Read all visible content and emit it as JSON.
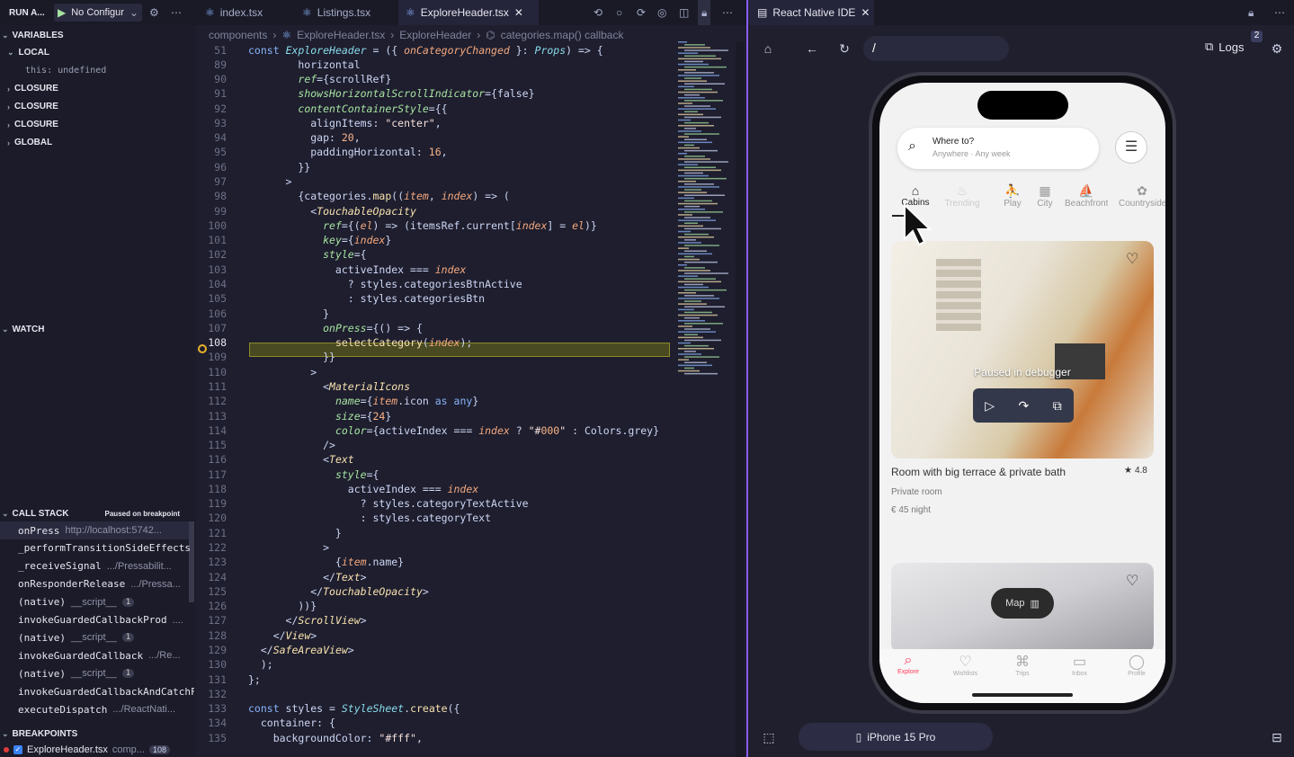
{
  "toolbar": {
    "run_label": "RUN A...",
    "config_label": "No Configur",
    "tabs": [
      {
        "label": "index.tsx"
      },
      {
        "label": "Listings.tsx"
      },
      {
        "label": "ExploreHeader.tsx"
      }
    ],
    "right_tab": "React Native IDE"
  },
  "debug": {
    "variables": "VARIABLES",
    "local": "LOCAL",
    "this_value": "this: undefined",
    "closures": [
      "CLOSURE",
      "CLOSURE",
      "CLOSURE"
    ],
    "global": "GLOBAL",
    "watch": "WATCH",
    "call_stack": "CALL STACK",
    "paused": "Paused on breakpoint",
    "frames": [
      {
        "fn": "onPress",
        "loc": "http://localhost:5742...",
        "badge": ""
      },
      {
        "fn": "_performTransitionSideEffects",
        "loc": "",
        "badge": ""
      },
      {
        "fn": "_receiveSignal",
        "loc": ".../Pressabilit...",
        "badge": ""
      },
      {
        "fn": "onResponderRelease",
        "loc": ".../Pressa...",
        "badge": ""
      },
      {
        "fn": "(native)",
        "loc": "__script__",
        "badge": "1"
      },
      {
        "fn": "invokeGuardedCallbackProd",
        "loc": "....",
        "badge": ""
      },
      {
        "fn": "(native)",
        "loc": "__script__",
        "badge": "1"
      },
      {
        "fn": "invokeGuardedCallback",
        "loc": ".../Re...",
        "badge": ""
      },
      {
        "fn": "(native)",
        "loc": "__script__",
        "badge": "1"
      },
      {
        "fn": "invokeGuardedCallbackAndCatchFirs",
        "loc": "",
        "badge": ""
      },
      {
        "fn": "executeDispatch",
        "loc": ".../ReactNati...",
        "badge": ""
      }
    ],
    "breakpoints": "BREAKPOINTS",
    "bp_file": "ExploreHeader.tsx",
    "bp_loc": "comp...",
    "bp_line": "108"
  },
  "breadcrumb": [
    "components",
    "ExploreHeader.tsx",
    "ExploreHeader",
    "categories.map() callback"
  ],
  "code": [
    {
      "n": "51",
      "t": "const ExploreHeader = ({ onCategoryChanged }: Props) => {"
    },
    {
      "n": "89",
      "t": "        horizontal"
    },
    {
      "n": "90",
      "t": "        ref={scrollRef}"
    },
    {
      "n": "91",
      "t": "        showsHorizontalScrollIndicator={false}"
    },
    {
      "n": "92",
      "t": "        contentContainerStyle={{"
    },
    {
      "n": "93",
      "t": "          alignItems: \"center\","
    },
    {
      "n": "94",
      "t": "          gap: 20,"
    },
    {
      "n": "95",
      "t": "          paddingHorizontal: 16,"
    },
    {
      "n": "96",
      "t": "        }}"
    },
    {
      "n": "97",
      "t": "      >"
    },
    {
      "n": "98",
      "t": "        {categories.map((item, index) => ("
    },
    {
      "n": "99",
      "t": "          <TouchableOpacity"
    },
    {
      "n": "100",
      "t": "            ref={(el) => (itemsRef.current[index] = el)}"
    },
    {
      "n": "101",
      "t": "            key={index}"
    },
    {
      "n": "102",
      "t": "            style={"
    },
    {
      "n": "103",
      "t": "              activeIndex === index"
    },
    {
      "n": "104",
      "t": "                ? styles.categoriesBtnActive"
    },
    {
      "n": "105",
      "t": "                : styles.categoriesBtn"
    },
    {
      "n": "106",
      "t": "            }"
    },
    {
      "n": "107",
      "t": "            onPress={() => {"
    },
    {
      "n": "108",
      "t": "              selectCategory(index);"
    },
    {
      "n": "109",
      "t": "            }}"
    },
    {
      "n": "110",
      "t": "          >"
    },
    {
      "n": "111",
      "t": "            <MaterialIcons"
    },
    {
      "n": "112",
      "t": "              name={item.icon as any}"
    },
    {
      "n": "113",
      "t": "              size={24}"
    },
    {
      "n": "114",
      "t": "              color={activeIndex === index ? \"#000\" : Colors.grey}"
    },
    {
      "n": "115",
      "t": "            />"
    },
    {
      "n": "116",
      "t": "            <Text"
    },
    {
      "n": "117",
      "t": "              style={"
    },
    {
      "n": "118",
      "t": "                activeIndex === index"
    },
    {
      "n": "119",
      "t": "                  ? styles.categoryTextActive"
    },
    {
      "n": "120",
      "t": "                  : styles.categoryText"
    },
    {
      "n": "121",
      "t": "              }"
    },
    {
      "n": "122",
      "t": "            >"
    },
    {
      "n": "123",
      "t": "              {item.name}"
    },
    {
      "n": "124",
      "t": "            </Text>"
    },
    {
      "n": "125",
      "t": "          </TouchableOpacity>"
    },
    {
      "n": "126",
      "t": "        ))}"
    },
    {
      "n": "127",
      "t": "      </ScrollView>"
    },
    {
      "n": "128",
      "t": "    </View>"
    },
    {
      "n": "129",
      "t": "  </SafeAreaView>"
    },
    {
      "n": "130",
      "t": "  );"
    },
    {
      "n": "131",
      "t": "};"
    },
    {
      "n": "132",
      "t": ""
    },
    {
      "n": "133",
      "t": "const styles = StyleSheet.create({"
    },
    {
      "n": "134",
      "t": "  container: {"
    },
    {
      "n": "135",
      "t": "    backgroundColor: \"#fff\","
    }
  ],
  "preview": {
    "url": "/",
    "logs": "Logs",
    "logs_count": "2",
    "device": "iPhone 15 Pro",
    "search_title": "Where to?",
    "search_sub": "Anywhere · Any week",
    "categories": [
      "Cabins",
      "Trending",
      "Play",
      "City",
      "Beachfront",
      "Countryside"
    ],
    "paused": "Paused in debugger",
    "listing_title": "Room with big terrace & private bath",
    "rating": "4.8",
    "room_type": "Private room",
    "price": "€ 45 night",
    "map_btn": "Map",
    "nav": [
      "Explore",
      "Wishlists",
      "Trips",
      "Inbox",
      "Profile"
    ]
  },
  "colors": {
    "accent": "#8b5cf6",
    "highlight": "#4a4a22",
    "airbnb": "#ff385c"
  }
}
